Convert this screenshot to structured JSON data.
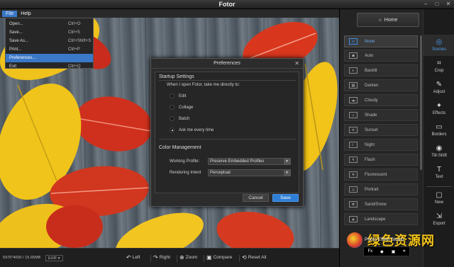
{
  "window": {
    "title": "Fotor"
  },
  "menubar": {
    "file": "File",
    "help": "Help"
  },
  "file_menu": [
    {
      "label": "Open...",
      "shortcut": "Ctrl+O"
    },
    {
      "label": "Save...",
      "shortcut": "Ctrl+S"
    },
    {
      "label": "Save As...",
      "shortcut": "Ctrl+Shift+S"
    },
    {
      "label": "Print...",
      "shortcut": "Ctrl+P"
    },
    {
      "label": "Preferences...",
      "shortcut": ""
    },
    {
      "label": "Exit",
      "shortcut": "Ctrl+Q"
    }
  ],
  "dialog": {
    "title": "Preferences",
    "startup_heading": "Startup Settings",
    "startup_question": "When I open Fotor, take me directly to:",
    "options": [
      "Edit",
      "Collage",
      "Batch",
      "Ask me every time"
    ],
    "selected_option": "Ask me every time",
    "color_heading": "Color Management",
    "working_profile_label": "Working Profile:",
    "working_profile_value": "Preserve Embedded Profiles",
    "rendering_intent_label": "Rendering Intent",
    "rendering_intent_value": "Perceptual",
    "cancel_label": "Cancel",
    "save_label": "Save"
  },
  "bottombar": {
    "dimensions": "5976*4000 / 15.65MB",
    "exif": "EXIF",
    "left": "Left",
    "right": "Right",
    "zoom": "Zoom",
    "compare": "Compare",
    "reset_all": "Reset All"
  },
  "home": {
    "label": "Home"
  },
  "scenes": [
    "None",
    "Auto",
    "Backlit",
    "Darken",
    "Cloudy",
    "Shade",
    "Sunset",
    "Night",
    "Flash",
    "Fluorescent",
    "Portrait",
    "Sand/Snow",
    "Landscape"
  ],
  "selected_scene": "None",
  "tools": [
    {
      "label": "Scenes",
      "icon": "scenes-icon"
    },
    {
      "label": "Crop",
      "icon": "crop-icon"
    },
    {
      "label": "Adjust",
      "icon": "adjust-icon"
    },
    {
      "label": "Effects",
      "icon": "effects-icon"
    },
    {
      "label": "Borders",
      "icon": "borders-icon"
    },
    {
      "label": "Tilt-Shift",
      "icon": "tilt-shift-icon"
    },
    {
      "label": "Text",
      "icon": "text-icon"
    },
    {
      "label": "New",
      "icon": "new-icon"
    },
    {
      "label": "Export",
      "icon": "export-icon"
    }
  ],
  "watermark": {
    "site": "绿色资源网",
    "studio": "Photo Effect Studio",
    "fx": "Fx"
  },
  "colors": {
    "accent": "#3a78c8",
    "save_button": "#2f7fd8",
    "selected_tool": "#4b9ef0"
  }
}
